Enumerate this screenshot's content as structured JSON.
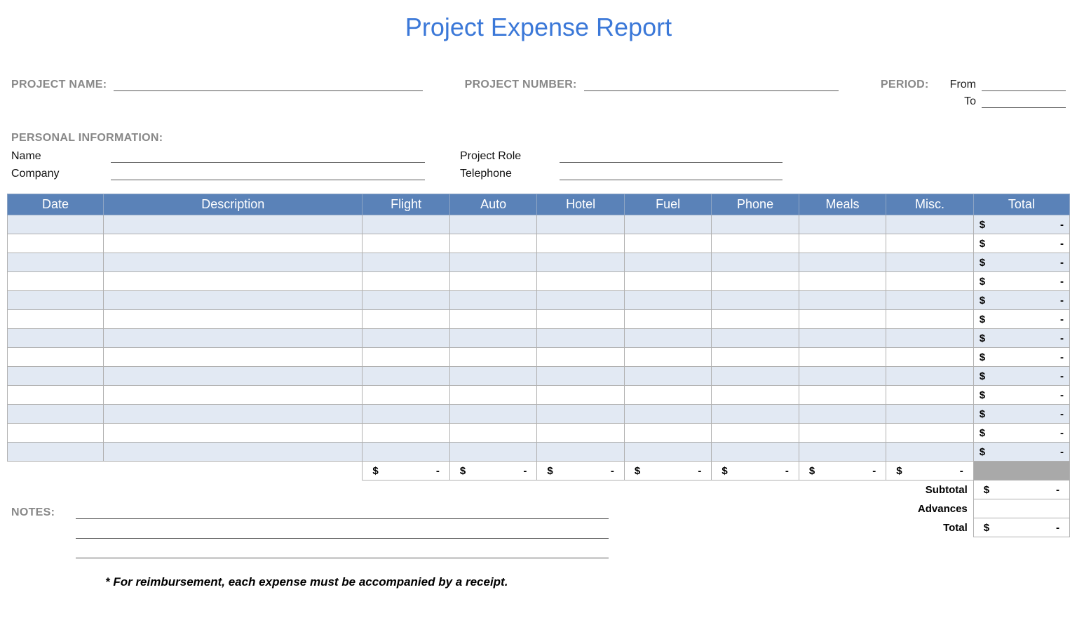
{
  "title": "Project Expense Report",
  "labels": {
    "project_name": "PROJECT NAME:",
    "project_number": "PROJECT NUMBER:",
    "period": "PERIOD:",
    "from": "From",
    "to": "To",
    "personal_info": "PERSONAL INFORMATION:",
    "name": "Name",
    "company": "Company",
    "project_role": "Project Role",
    "telephone": "Telephone",
    "notes": "NOTES:",
    "subtotal": "Subtotal",
    "advances": "Advances",
    "total": "Total"
  },
  "columns": [
    "Date",
    "Description",
    "Flight",
    "Auto",
    "Hotel",
    "Fuel",
    "Phone",
    "Meals",
    "Misc.",
    "Total"
  ],
  "rows_count": 13,
  "currency": "$",
  "dash": "-",
  "column_sums": [
    "-",
    "-",
    "-",
    "-",
    "-",
    "-",
    "-"
  ],
  "summary": {
    "subtotal": "-",
    "advances": "",
    "total": "-"
  },
  "footnote": "* For reimbursement, each expense must be accompanied by a receipt."
}
